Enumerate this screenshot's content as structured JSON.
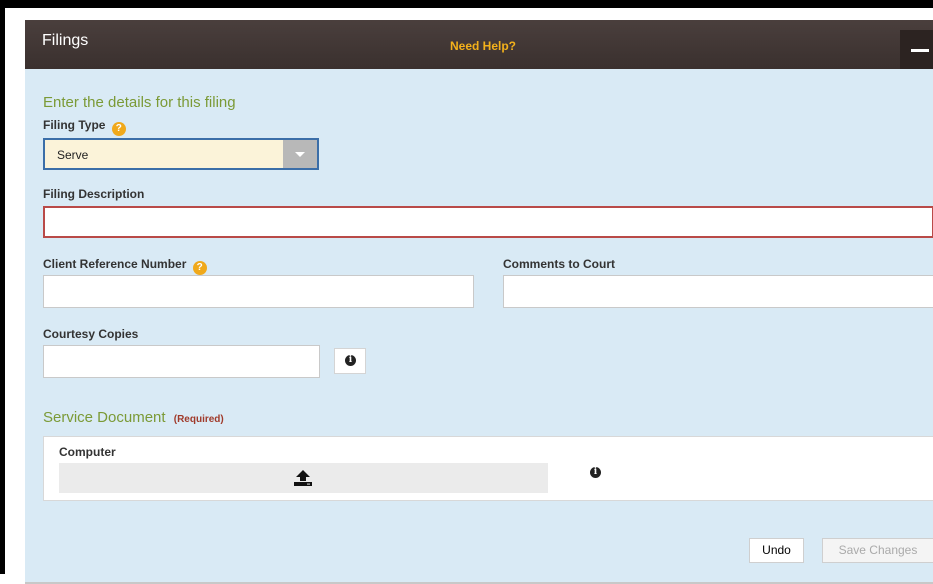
{
  "header": {
    "title": "Filings",
    "help_link": "Need Help?"
  },
  "form": {
    "section_title": "Enter the details for this filing",
    "filing_type": {
      "label": "Filing Type",
      "help_badge": "?",
      "selected": "Serve"
    },
    "filing_description": {
      "label": "Filing Description",
      "value": ""
    },
    "client_reference": {
      "label": "Client Reference Number",
      "help_badge": "?",
      "value": ""
    },
    "comments_to_court": {
      "label": "Comments to Court",
      "value": ""
    },
    "courtesy_copies": {
      "label": "Courtesy Copies",
      "value": ""
    }
  },
  "service_document": {
    "title": "Service Document",
    "required_label": "(Required)",
    "source_label": "Computer"
  },
  "footer": {
    "undo_label": "Undo",
    "save_label": "Save Changes"
  },
  "colors": {
    "header_bg": "#3f3533",
    "help_link": "#f3b11b",
    "section_title": "#7b9a36",
    "panel_bg": "#d9eaf5",
    "error_border": "#b94a48",
    "help_badge": "#f0a91b"
  }
}
